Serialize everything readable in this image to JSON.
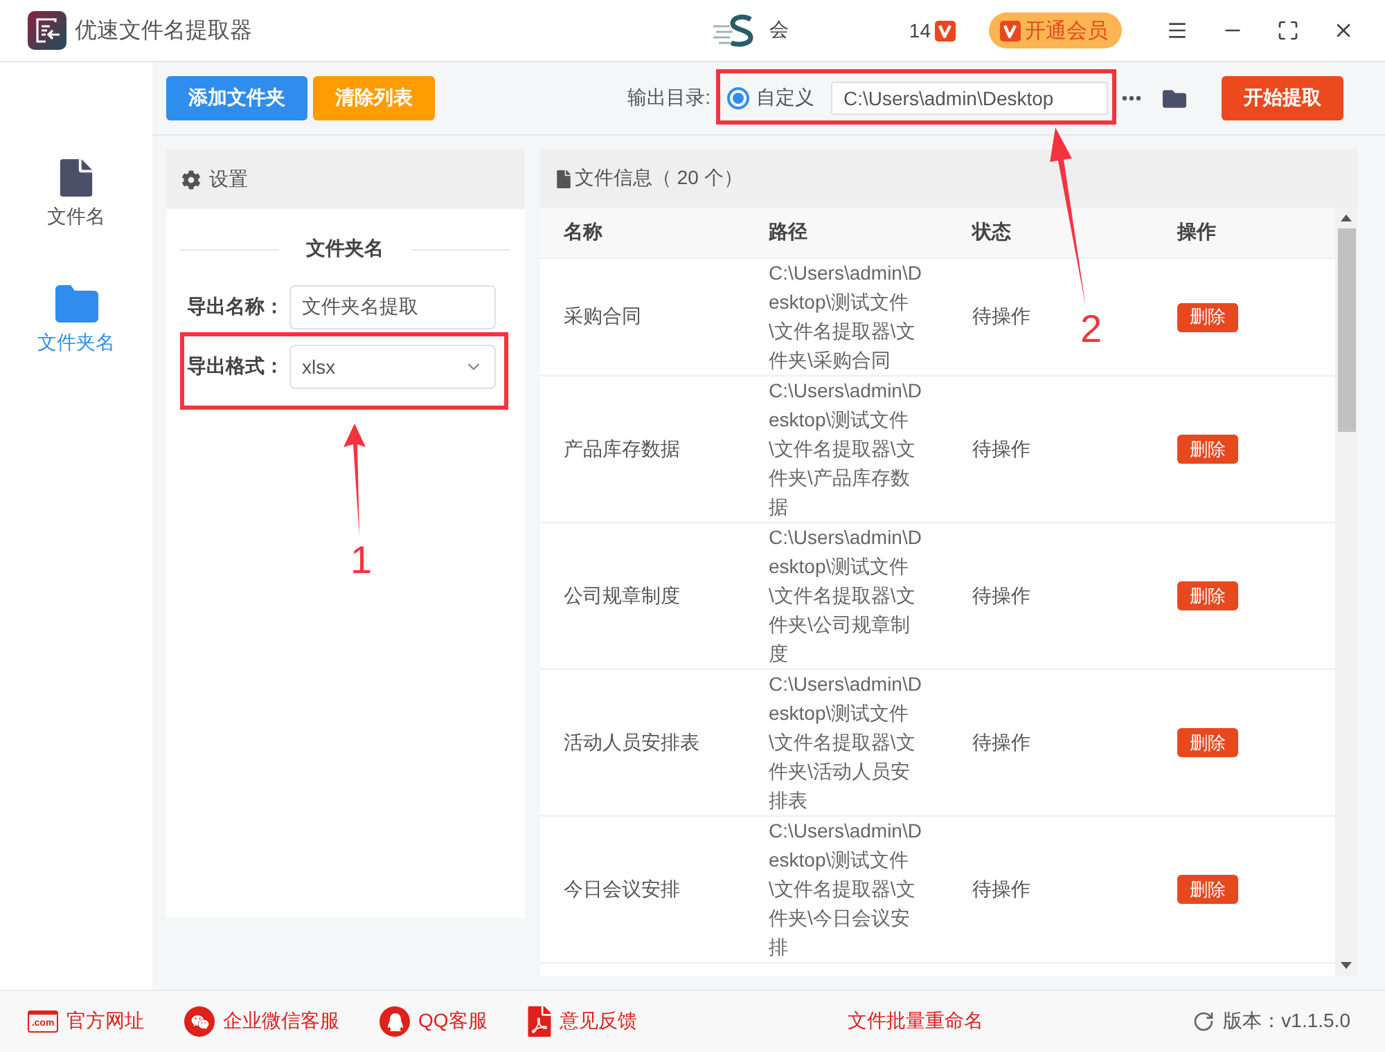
{
  "window": {
    "title": "优速文件名提取器",
    "user_label": "会",
    "user_suffix": "14",
    "vip_button": "开通会员"
  },
  "sidebar": {
    "items": [
      {
        "label": "文件名",
        "kind": "file",
        "selected": false
      },
      {
        "label": "文件夹名",
        "kind": "folder",
        "selected": true
      }
    ]
  },
  "toolbar": {
    "buttons": [
      {
        "label": "添加文件夹",
        "kind": "primary"
      },
      {
        "label": "清除列表",
        "kind": "warning"
      }
    ],
    "output_label": "输出目录:",
    "output_option": {
      "label": "自定义",
      "selected": true
    },
    "output_path": "C:\\Users\\admin\\Desktop",
    "start_button": "开始提取"
  },
  "settings": {
    "title": "设置",
    "section_title": "文件夹名",
    "fields": [
      {
        "label": "导出名称：",
        "kind": "text",
        "value": "文件夹名提取"
      },
      {
        "label": "导出格式：",
        "kind": "select",
        "value": "xlsx"
      }
    ]
  },
  "file_panel": {
    "title": "文件信息（ 20 个）",
    "columns": [
      "名称",
      "路径",
      "状态",
      "操作"
    ],
    "rows": [
      {
        "name": "采购合同",
        "path": "C:\\Users\\admin\\Desktop\\测试文件\\文件名提取器\\文件夹\\采购合同",
        "status": "待操作",
        "action": "删除"
      },
      {
        "name": "产品库存数据",
        "path": "C:\\Users\\admin\\Desktop\\测试文件\\文件名提取器\\文件夹\\产品库存数据",
        "status": "待操作",
        "action": "删除"
      },
      {
        "name": "公司规章制度",
        "path": "C:\\Users\\admin\\Desktop\\测试文件\\文件名提取器\\文件夹\\公司规章制度",
        "status": "待操作",
        "action": "删除"
      },
      {
        "name": "活动人员安排表",
        "path": "C:\\Users\\admin\\Desktop\\测试文件\\文件名提取器\\文件夹\\活动人员安排表",
        "status": "待操作",
        "action": "删除"
      },
      {
        "name": "今日会议安排",
        "path": "C:\\Users\\admin\\Desktop\\测试文件\\文件名提取器\\文件夹\\今日会议安排",
        "status": "待操作",
        "action": "删除"
      }
    ]
  },
  "footer": {
    "links": [
      {
        "label": "官方网址",
        "kind": "web",
        "icon_text": ".com"
      },
      {
        "label": "企业微信客服",
        "kind": "wechat"
      },
      {
        "label": "QQ客服",
        "kind": "qq"
      },
      {
        "label": "意见反馈",
        "kind": "feedback"
      }
    ],
    "center_link": "文件批量重命名",
    "version": "版本：v1.1.5.0"
  },
  "annotations": [
    {
      "label": "1",
      "kind": "format-field"
    },
    {
      "label": "2",
      "kind": "output-path"
    }
  ]
}
